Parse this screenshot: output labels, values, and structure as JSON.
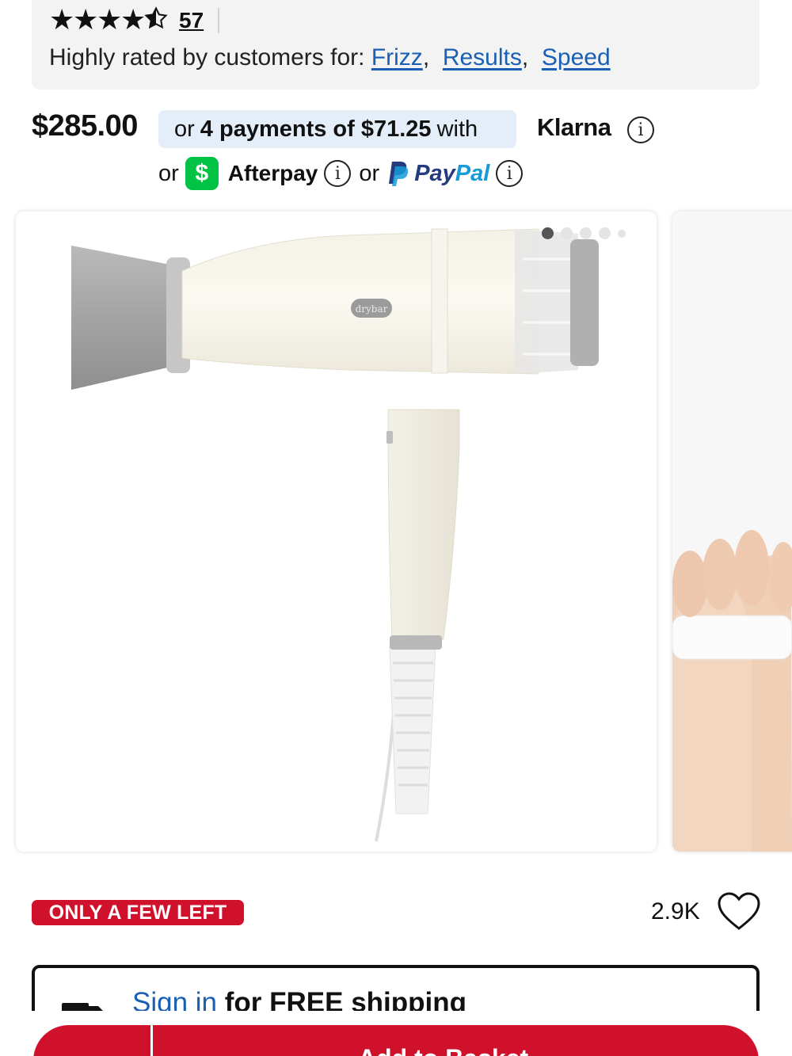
{
  "reviews": {
    "rating_value": 4.5,
    "rating_max": 5,
    "count": "57",
    "highlights_label": "Highly rated by customers for:",
    "highlights": [
      "Frizz",
      "Results",
      "Speed"
    ]
  },
  "pricing": {
    "price": "$285.00",
    "klarna_prefix": "or",
    "klarna_bold": "4 payments of $71.25",
    "klarna_suffix": "with",
    "klarna_brand": "Klarna",
    "or_1": "or",
    "afterpay_brand": "Afterpay",
    "or_2": "or",
    "paypal_brand_1": "Pay",
    "paypal_brand_2": "Pal",
    "info_glyph": "i",
    "cash_glyph": "$"
  },
  "gallery": {
    "image_brand_text": "drybar",
    "slides_total": 5,
    "active_slide": 1
  },
  "product_status": {
    "stock_badge": "ONLY A FEW LEFT",
    "loves_count": "2.9K"
  },
  "shipping": {
    "sign_in_link": "Sign in",
    "shipping_text": "for FREE shipping"
  },
  "cta": {
    "add_to_basket": "Add to Basket"
  },
  "colors": {
    "accent_red": "#cf112c",
    "link_blue": "#1a5fb4",
    "klarna_pill_bg": "#e4eef8",
    "cashapp_green": "#00c244",
    "paypal_navy": "#253b80",
    "paypal_light": "#179bd7"
  },
  "icons": [
    "star-icon",
    "info-icon",
    "cashapp-icon",
    "paypal-icon",
    "heart-icon",
    "truck-icon"
  ]
}
